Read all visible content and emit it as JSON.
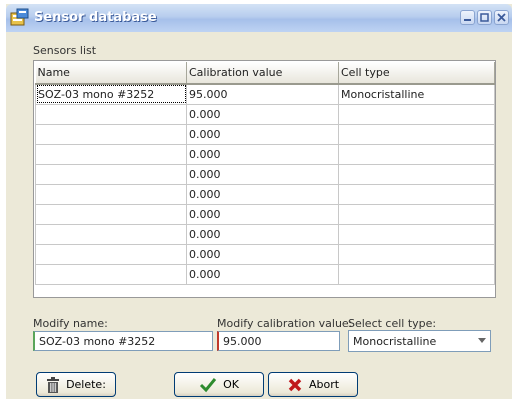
{
  "window": {
    "title": "Sensor database"
  },
  "sensors": {
    "label": "Sensors list",
    "columns": [
      "Name",
      "Calibration value",
      "Cell type"
    ],
    "rows": [
      [
        "SOZ-03 mono #3252",
        "95.000",
        "Monocristalline"
      ],
      [
        "",
        "0.000",
        ""
      ],
      [
        "",
        "0.000",
        ""
      ],
      [
        "",
        "0.000",
        ""
      ],
      [
        "",
        "0.000",
        ""
      ],
      [
        "",
        "0.000",
        ""
      ],
      [
        "",
        "0.000",
        ""
      ],
      [
        "",
        "0.000",
        ""
      ],
      [
        "",
        "0.000",
        ""
      ],
      [
        "",
        "0.000",
        ""
      ]
    ]
  },
  "form": {
    "name_label": "Modify name:",
    "name_value": "SOZ-03 mono #3252",
    "calibration_label": "Modify calibration value:",
    "calibration_value": "95.000",
    "celltype_label": "Select cell type:",
    "celltype_value": "Monocristalline"
  },
  "buttons": {
    "delete": "Delete:",
    "ok": "OK",
    "abort": "Abort"
  },
  "icons": {
    "app": "database-icon",
    "minimize": "minimize-icon",
    "maximize": "maximize-icon",
    "close": "close-icon",
    "delete": "trash-icon",
    "ok": "checkmark-icon",
    "abort": "cross-icon"
  },
  "colors": {
    "ok_green": "#2e8b2e",
    "abort_red": "#c0191b",
    "title_bar": "#b7cdee"
  }
}
